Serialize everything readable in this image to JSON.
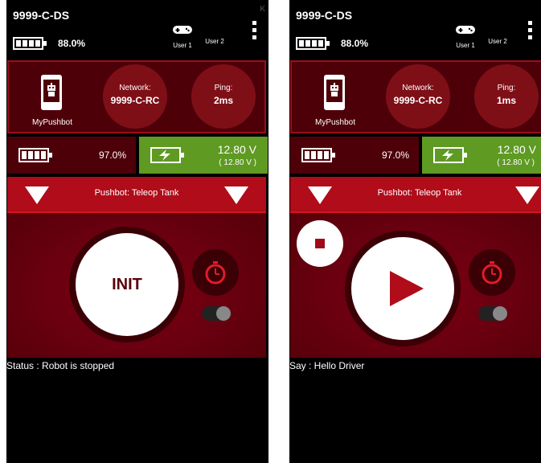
{
  "colors": {
    "background": "#000000",
    "panel_dark": "#4e0009",
    "panel_border": "#9a0e19",
    "opmode_bar": "#b00c1a",
    "voltage_ok": "#5f9a23",
    "control_area": "#5a000a",
    "accent_red": "#a00a16"
  },
  "screens": [
    {
      "title": "9999-C-DS",
      "corner_mark": "K",
      "phone_battery": "88.0%",
      "gamepads": [
        {
          "label": "User 1"
        },
        {
          "label": "User 2"
        }
      ],
      "robot": {
        "name": "MyPushbot"
      },
      "network": {
        "label": "Network:",
        "value": "9999-C-RC"
      },
      "ping": {
        "label": "Ping:",
        "value": "2ms"
      },
      "rc_battery": "97.0%",
      "voltage": {
        "main": "12.80 V",
        "sub": "( 12.80 V )"
      },
      "opmode": "Pushbot: Teleop Tank",
      "main_button": "INIT",
      "status": "Status : Robot is stopped"
    },
    {
      "title": "9999-C-DS",
      "phone_battery": "88.0%",
      "gamepads": [
        {
          "label": "User 1"
        },
        {
          "label": "User 2"
        }
      ],
      "robot": {
        "name": "MyPushbot"
      },
      "network": {
        "label": "Network:",
        "value": "9999-C-RC"
      },
      "ping": {
        "label": "Ping:",
        "value": "1ms"
      },
      "rc_battery": "97.0%",
      "voltage": {
        "main": "12.80 V",
        "sub": "( 12.80 V )"
      },
      "opmode": "Pushbot: Teleop Tank",
      "main_button": "play",
      "status": "Say : Hello Driver"
    }
  ],
  "icons": {
    "battery": "battery-icon",
    "charging": "charging-battery-icon",
    "gamepad": "gamepad-icon",
    "menu": "more-vert-icon",
    "robot": "robot-phone-icon",
    "timer": "stopwatch-icon",
    "play": "play-icon",
    "stop": "stop-icon",
    "dropdown": "triangle-down-icon"
  }
}
